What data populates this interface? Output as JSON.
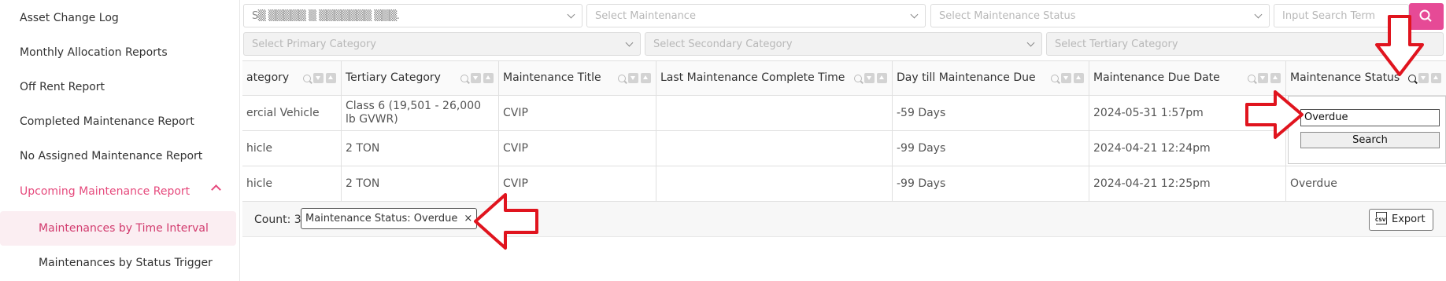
{
  "sidebar": {
    "items": [
      {
        "label": "Asset Change Log"
      },
      {
        "label": "Monthly Allocation Reports"
      },
      {
        "label": "Off Rent Report"
      },
      {
        "label": "Completed Maintenance Report"
      },
      {
        "label": "No Assigned Maintenance Report"
      },
      {
        "label": "Upcoming Maintenance Report"
      }
    ],
    "subitems": [
      {
        "label": "Maintenances by Time Interval"
      },
      {
        "label": "Maintenances by Status Trigger"
      }
    ]
  },
  "filters": {
    "company": {
      "value": "S▒ ▒▒▒▒▒ ▒ ▒▒▒▒▒▒▒ ▒▒▒."
    },
    "maintenance": {
      "placeholder": "Select Maintenance"
    },
    "maintenance_status": {
      "placeholder": "Select Maintenance Status"
    },
    "search": {
      "placeholder": "Input Search Term"
    },
    "primary_category": {
      "placeholder": "Select Primary Category"
    },
    "secondary_category": {
      "placeholder": "Select Secondary Category"
    },
    "tertiary_category": {
      "placeholder": "Select Tertiary Category"
    }
  },
  "table": {
    "columns": [
      {
        "label": "ategory"
      },
      {
        "label": "Tertiary Category"
      },
      {
        "label": "Maintenance Title"
      },
      {
        "label": "Last Maintenance Complete Time"
      },
      {
        "label": "Day till Maintenance Due"
      },
      {
        "label": "Maintenance Due Date"
      },
      {
        "label": "Maintenance Status"
      }
    ],
    "rows": [
      {
        "c0": "ercial Vehicle",
        "c1": "Class 6 (19,501 - 26,000 lb GVWR)",
        "c2": "CVIP",
        "c3": "",
        "c4": "-59 Days",
        "c5": "2024-05-31 1:57pm",
        "c6": ""
      },
      {
        "c0": "hicle",
        "c1": "2 TON",
        "c2": "CVIP",
        "c3": "",
        "c4": "-99 Days",
        "c5": "2024-04-21 12:24pm",
        "c6": ""
      },
      {
        "c0": "hicle",
        "c1": "2 TON",
        "c2": "CVIP",
        "c3": "",
        "c4": "-99 Days",
        "c5": "2024-04-21 12:25pm",
        "c6": "Overdue"
      }
    ]
  },
  "status_search_popup": {
    "input_value": "Overdue",
    "button_label": "Search"
  },
  "footer": {
    "count_label": "Count: 3",
    "chip_label": "Maintenance Status: Overdue",
    "chip_close": "×",
    "export_label": "Export",
    "csv_icon_text": "CSV"
  },
  "colors": {
    "accent": "#e64a7d",
    "search_button": "#e64a96",
    "annotation_arrow": "#e0141e"
  }
}
